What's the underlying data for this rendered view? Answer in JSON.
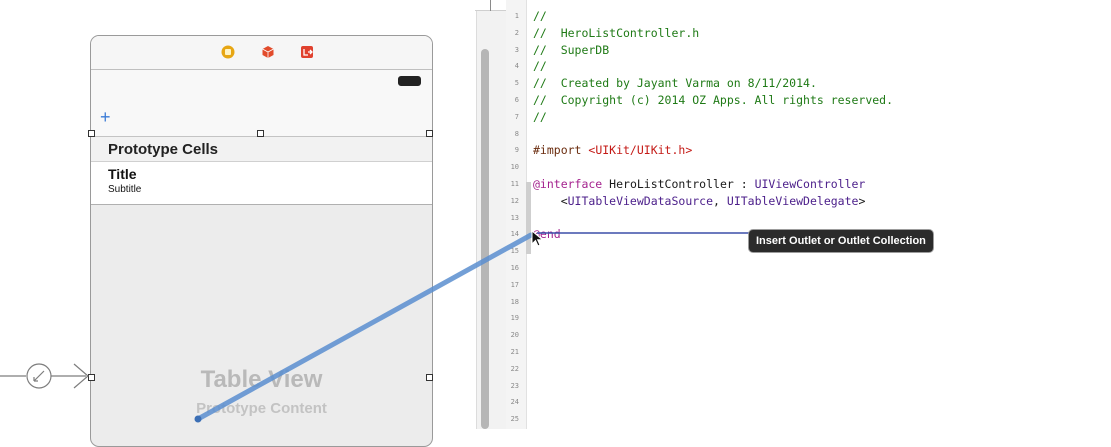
{
  "storyboard": {
    "scene_dock_icons": [
      "view-controller-icon",
      "first-responder-icon",
      "exit-icon"
    ],
    "nav_add_button": "+",
    "section_header": "Prototype Cells",
    "cell": {
      "title": "Title",
      "subtitle": "Subtitle"
    },
    "placeholder": {
      "title": "Table View",
      "subtitle": "Prototype Content"
    },
    "entry_arrow_icon": "initial-scene-arrow-icon"
  },
  "editor": {
    "lines": [
      {
        "number": "1",
        "tokens": [
          {
            "t": "//",
            "c": "comment"
          }
        ]
      },
      {
        "number": "2",
        "tokens": [
          {
            "t": "//  HeroListController.h",
            "c": "comment"
          }
        ]
      },
      {
        "number": "3",
        "tokens": [
          {
            "t": "//  SuperDB",
            "c": "comment"
          }
        ]
      },
      {
        "number": "4",
        "tokens": [
          {
            "t": "//",
            "c": "comment"
          }
        ]
      },
      {
        "number": "5",
        "tokens": [
          {
            "t": "//  Created by Jayant Varma on 8/11/2014.",
            "c": "comment"
          }
        ]
      },
      {
        "number": "6",
        "tokens": [
          {
            "t": "//  Copyright (c) 2014 OZ Apps. All rights reserved.",
            "c": "comment"
          }
        ]
      },
      {
        "number": "7",
        "tokens": [
          {
            "t": "//",
            "c": "comment"
          }
        ]
      },
      {
        "number": "8",
        "tokens": []
      },
      {
        "number": "9",
        "tokens": [
          {
            "t": "#import ",
            "c": "directive"
          },
          {
            "t": "<UIKit/UIKit.h>",
            "c": "string"
          }
        ]
      },
      {
        "number": "10",
        "tokens": []
      },
      {
        "number": "11",
        "tokens": [
          {
            "t": "@interface",
            "c": "keyword"
          },
          {
            "t": " HeroListController : ",
            "c": "plain"
          },
          {
            "t": "UIViewController",
            "c": "type"
          }
        ]
      },
      {
        "number": "12",
        "tokens": [
          {
            "t": "    <",
            "c": "plain"
          },
          {
            "t": "UITableViewDataSource",
            "c": "type"
          },
          {
            "t": ", ",
            "c": "plain"
          },
          {
            "t": "UITableViewDelegate",
            "c": "type"
          },
          {
            "t": ">",
            "c": "plain"
          }
        ]
      },
      {
        "number": "13",
        "tokens": []
      },
      {
        "number": "14",
        "tokens": [
          {
            "t": "@end",
            "c": "keyword"
          }
        ]
      },
      {
        "number": "15",
        "tokens": []
      },
      {
        "number": "16",
        "tokens": []
      },
      {
        "number": "17",
        "tokens": []
      },
      {
        "number": "18",
        "tokens": []
      },
      {
        "number": "19",
        "tokens": []
      },
      {
        "number": "20",
        "tokens": []
      },
      {
        "number": "21",
        "tokens": []
      },
      {
        "number": "22",
        "tokens": []
      },
      {
        "number": "23",
        "tokens": []
      },
      {
        "number": "24",
        "tokens": []
      },
      {
        "number": "25",
        "tokens": []
      }
    ]
  },
  "tooltip": "Insert Outlet or Outlet Collection",
  "colors": {
    "connection_line": "#5b8fd0",
    "insertion_line": "#3b4fa8",
    "comment": "#1f7a16",
    "keyword": "#a4238e",
    "type": "#4b1e8a",
    "string": "#c41a16",
    "directive": "#6b2d0f"
  }
}
